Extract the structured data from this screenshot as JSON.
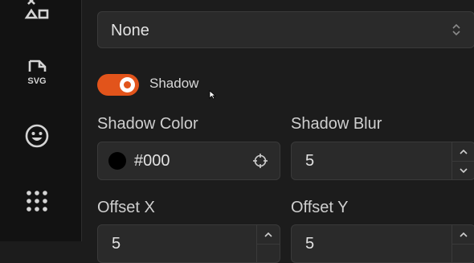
{
  "sidebar": {
    "items": [
      {
        "icon": "shapes-icon"
      },
      {
        "icon": "svg-file-icon",
        "label": "SVG"
      },
      {
        "icon": "emoji-icon"
      },
      {
        "icon": "dot-grid-icon"
      }
    ]
  },
  "select": {
    "value": "None"
  },
  "shadow_toggle": {
    "label": "Shadow",
    "on": true,
    "color": "#e2541b"
  },
  "shadow_color": {
    "label": "Shadow Color",
    "value": "#000",
    "swatch": "#000000"
  },
  "shadow_blur": {
    "label": "Shadow Blur",
    "value": "5"
  },
  "offset_x": {
    "label": "Offset X",
    "value": "5"
  },
  "offset_y": {
    "label": "Offset Y",
    "value": "5"
  }
}
